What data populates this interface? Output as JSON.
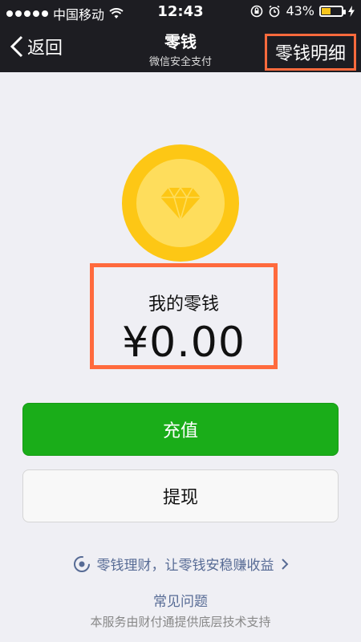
{
  "status_bar": {
    "carrier": "中国移动",
    "time": "12:43",
    "battery": "43%"
  },
  "nav": {
    "back_label": "返回",
    "title": "零钱",
    "subtitle": "微信安全支付",
    "detail_label": "零钱明细"
  },
  "balance": {
    "label": "我的零钱",
    "amount": "¥0.00"
  },
  "actions": {
    "recharge_label": "充值",
    "withdraw_label": "提现"
  },
  "promo": {
    "text": "零钱理财，让零钱安稳赚收益"
  },
  "faq_label": "常见问题",
  "footer_text": "本服务由财付通提供底层技术支持",
  "colors": {
    "accent_green": "#1aad19",
    "highlight": "#ff6a3d",
    "link": "#576b95",
    "coin": "#fdc715"
  }
}
